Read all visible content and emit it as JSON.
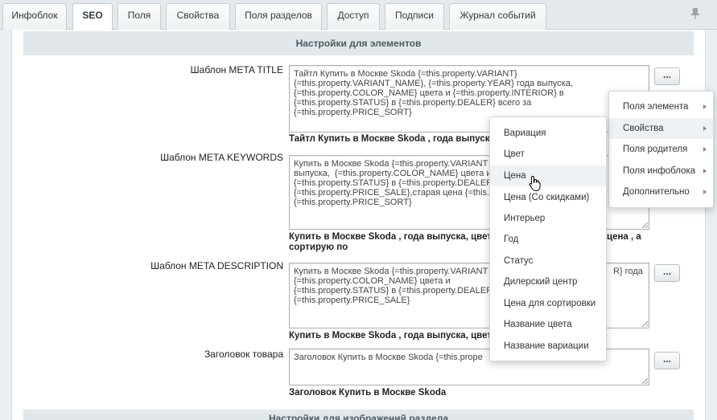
{
  "tabs": [
    "Инфоблок",
    "SEO",
    "Поля",
    "Свойства",
    "Поля разделов",
    "Доступ",
    "Подписи",
    "Журнал событий"
  ],
  "section_title": "Настройки для элементов",
  "bottom_section_title": "Настройки для изображений раздела",
  "fields": {
    "meta_title": {
      "label": "Шаблон META TITLE",
      "value": "Тайтл Купить в Москве Skoda {=this.property.VARIANT}\n{=this.property.VARIANT_NAME}, {=this.property.YEAR} года выпуска,\n{=this.property.COLOR_NAME} цвета и {=this.property.INTERIOR} в\n{=this.property.STATUS} в {=this.property.DEALER} всего за\n{=this.property.PRICE_SORT}",
      "preview": "Тайтл Купить в Москве Skoda , года выпуска",
      "button": "..."
    },
    "meta_keywords": {
      "label": "Шаблон META KEYWORDS",
      "value": "Купить в Москве Skoda {=this.property.VARIANT\nвыпуска,  {=this.property.COLOR_NAME} цвета и\n{=this.property.STATUS} в {=this.property.DEALER\n{=this.property.PRICE_SALE},старая цена {=this.\n{=this.property.PRICE_SORT}",
      "preview_line1": "Купить в Москве Skoda , года выпуска, цвета",
      "preview_line1_end": "цена , а",
      "preview_line2": "сортирую по"
    },
    "meta_description": {
      "label": "Шаблон META DESCRIPTION",
      "value": "Купить в Москве Skoda {=this.property.VARIANT\n{=this.property.COLOR_NAME} цвета и\n{=this.property.STATUS} в {=this.property.DEALER\n{=this.property.PRICE_SALE}",
      "value_tail": "R} года",
      "preview": "Купить в Москве Skoda , года выпуска, цвета",
      "button": "..."
    },
    "product_heading": {
      "label": "Заголовок товара",
      "value": "Заголовок Купить в Москве Skoda {=this.prope",
      "preview": "Заголовок Купить в Москве Skoda",
      "button": "..."
    }
  },
  "submenu": {
    "items": [
      "Вариация",
      "Цвет",
      "Цена",
      "Цена (Со скидками)",
      "Интерьер",
      "Год",
      "Статус",
      "Дилерский центр",
      "Цена для сортировки",
      "Название цвета",
      "Название вариации"
    ],
    "highlighted": "Цена"
  },
  "menu": {
    "items": [
      "Поля элемента",
      "Свойства",
      "Поля родителя",
      "Поля инфоблока",
      "Дополнительно"
    ],
    "highlighted": "Свойства"
  }
}
